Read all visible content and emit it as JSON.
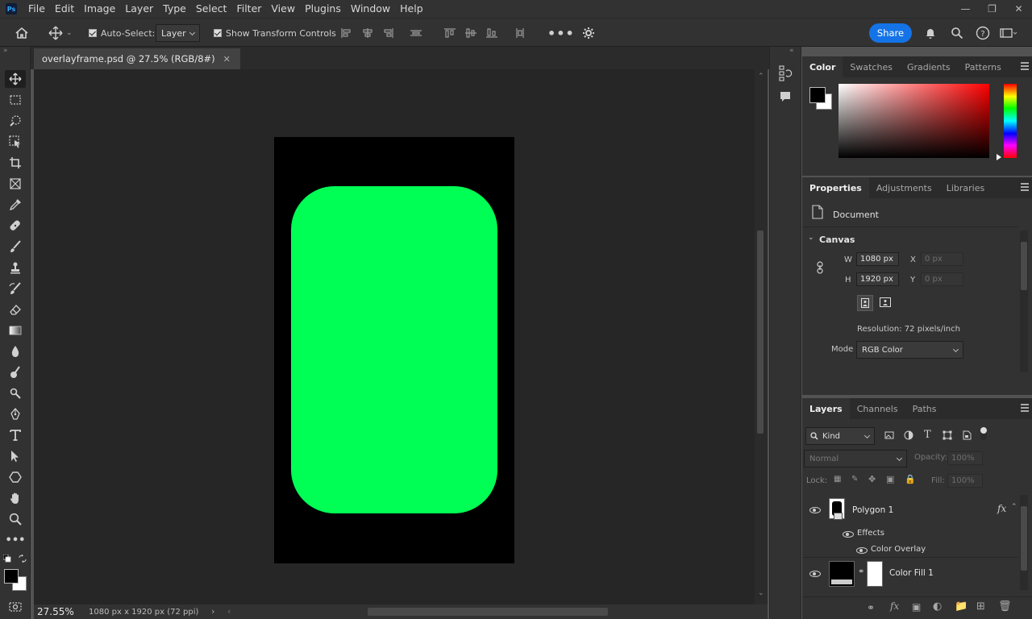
{
  "menubar": {
    "logo": "Ps",
    "items": [
      "File",
      "Edit",
      "Image",
      "Layer",
      "Type",
      "Select",
      "Filter",
      "View",
      "Plugins",
      "Window",
      "Help"
    ]
  },
  "options": {
    "auto_select_label": "Auto-Select:",
    "auto_select_value": "Layer",
    "show_transform_label": "Show Transform Controls",
    "share_label": "Share"
  },
  "document": {
    "tab_title": "overlayframe.psd @ 27.5% (RGB/8#)",
    "zoom": "27.55%",
    "info": "1080 px x 1920 px (72 ppi)"
  },
  "color_panel": {
    "tabs": [
      "Color",
      "Swatches",
      "Gradients",
      "Patterns"
    ],
    "foreground": "#000000",
    "background": "#ffffff"
  },
  "properties_panel": {
    "tabs": [
      "Properties",
      "Adjustments",
      "Libraries"
    ],
    "doc_label": "Document",
    "section": "Canvas",
    "w_label": "W",
    "w_value": "1080 px",
    "h_label": "H",
    "h_value": "1920 px",
    "x_label": "X",
    "x_value": "0 px",
    "y_label": "Y",
    "y_value": "0 px",
    "resolution": "Resolution: 72 pixels/inch",
    "mode_label": "Mode",
    "mode_value": "RGB Color"
  },
  "layers_panel": {
    "tabs": [
      "Layers",
      "Channels",
      "Paths"
    ],
    "filter_kind": "Kind",
    "blend_mode": "Normal",
    "opacity_label": "Opacity:",
    "opacity_value": "100%",
    "lock_label": "Lock:",
    "fill_label": "Fill:",
    "fill_value": "100%",
    "layers": [
      {
        "name": "Polygon 1",
        "fx": "fx"
      },
      {
        "name": "Effects"
      },
      {
        "name": "Color Overlay"
      },
      {
        "name": "Color Fill 1"
      }
    ]
  },
  "colors": {
    "shape_fill": "#00ff55",
    "accent": "#1473e6"
  }
}
